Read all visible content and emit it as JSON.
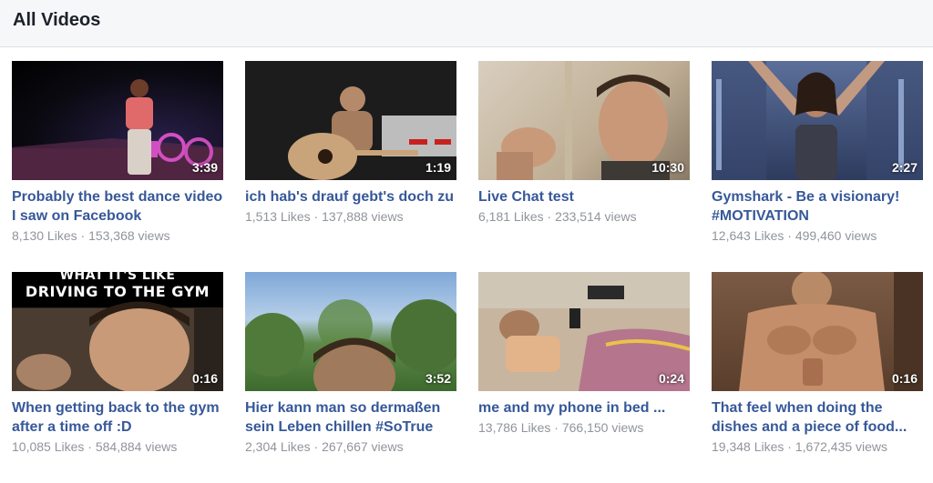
{
  "page": {
    "heading": "All Videos"
  },
  "videos": [
    {
      "title": "Probably the best dance video I saw on Facebook",
      "duration": "3:39",
      "likes": "8,130 Likes",
      "views": "153,368 views"
    },
    {
      "title": "ich hab's drauf gebt's doch zu",
      "duration": "1:19",
      "likes": "1,513 Likes",
      "views": "137,888 views"
    },
    {
      "title": "Live Chat test",
      "duration": "10:30",
      "likes": "6,181 Likes",
      "views": "233,514 views"
    },
    {
      "title": "Gymshark - Be a visionary! #MOTIVATION",
      "duration": "2:27",
      "likes": "12,643 Likes",
      "views": "499,460 views"
    },
    {
      "title": "When getting back to the gym after a time off :D",
      "duration": "0:16",
      "likes": "10,085 Likes",
      "views": "584,884 views",
      "overlay_text_1": "WHAT IT'S LIKE",
      "overlay_text_2": "DRIVING TO THE GYM"
    },
    {
      "title": "Hier kann man so dermaßen sein Leben chillen #SoTrue",
      "duration": "3:52",
      "likes": "2,304 Likes",
      "views": "267,667 views"
    },
    {
      "title": "me and my phone in bed ...",
      "duration": "0:24",
      "likes": "13,786 Likes",
      "views": "766,150 views"
    },
    {
      "title": "That feel when doing the dishes and a piece of food...",
      "duration": "0:16",
      "likes": "19,348 Likes",
      "views": "1,672,435 views"
    }
  ],
  "colors": {
    "title_link": "#365899",
    "meta_text": "#90949c",
    "header_bg": "#f6f7f9"
  }
}
